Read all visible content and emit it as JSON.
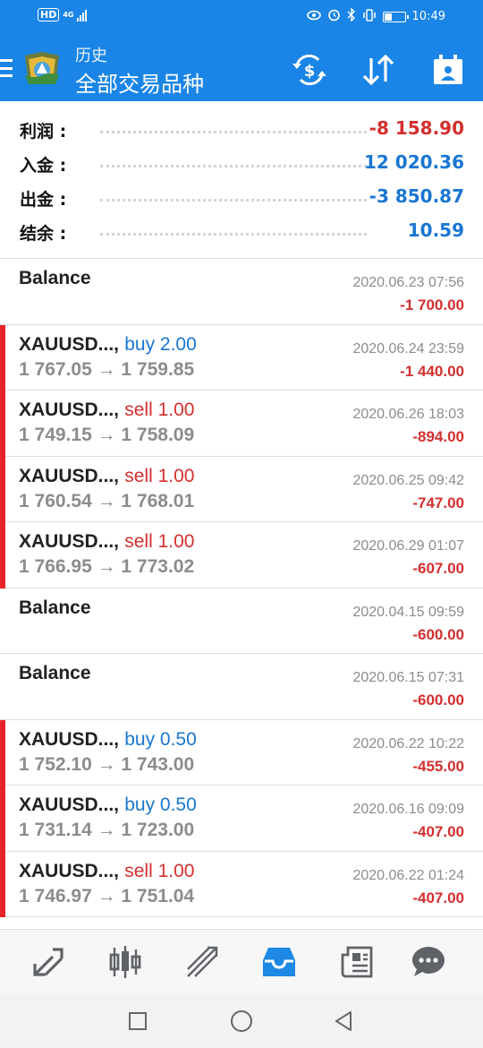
{
  "status_bar": {
    "hd": "HD",
    "network": "4G",
    "time": "10:49",
    "battery_level": 0.35
  },
  "header": {
    "subtitle": "历史",
    "title": "全部交易品种",
    "actions": [
      "currency-exchange-icon",
      "sort-icon",
      "calendar-icon"
    ]
  },
  "summary": [
    {
      "label": "利润 :",
      "value": "-8 158.90",
      "color": "#d32f2f"
    },
    {
      "label": "入金 :",
      "value": "12 020.36",
      "color": "#1976d2"
    },
    {
      "label": "出金 :",
      "value": "-3 850.87",
      "color": "#1976d2"
    },
    {
      "label": "结余 :",
      "value": "10.59",
      "color": "#1976d2"
    }
  ],
  "deals": [
    {
      "kind": "balance",
      "title": "Balance",
      "time": "2020.06.23 07:56",
      "profit": "-1 700.00"
    },
    {
      "kind": "trade",
      "symbol": "XAUUSD...,",
      "side": "buy 2.00",
      "side_color": "#1976d2",
      "prices": "1 767.05 → 1 759.85",
      "time": "2020.06.24 23:59",
      "profit": "-1 440.00"
    },
    {
      "kind": "trade",
      "symbol": "XAUUSD...,",
      "side": "sell 1.00",
      "side_color": "#d32f2f",
      "prices": "1 749.15 → 1 758.09",
      "time": "2020.06.26 18:03",
      "profit": "-894.00"
    },
    {
      "kind": "trade",
      "symbol": "XAUUSD...,",
      "side": "sell 1.00",
      "side_color": "#d32f2f",
      "prices": "1 760.54 → 1 768.01",
      "time": "2020.06.25 09:42",
      "profit": "-747.00"
    },
    {
      "kind": "trade",
      "symbol": "XAUUSD...,",
      "side": "sell 1.00",
      "side_color": "#d32f2f",
      "prices": "1 766.95 → 1 773.02",
      "time": "2020.06.29 01:07",
      "profit": "-607.00"
    },
    {
      "kind": "balance",
      "title": "Balance",
      "time": "2020.04.15 09:59",
      "profit": "-600.00"
    },
    {
      "kind": "balance",
      "title": "Balance",
      "time": "2020.06.15 07:31",
      "profit": "-600.00"
    },
    {
      "kind": "trade",
      "symbol": "XAUUSD...,",
      "side": "buy 0.50",
      "side_color": "#1976d2",
      "prices": "1 752.10 → 1 743.00",
      "time": "2020.06.22 10:22",
      "profit": "-455.00"
    },
    {
      "kind": "trade",
      "symbol": "XAUUSD...,",
      "side": "buy 0.50",
      "side_color": "#1976d2",
      "prices": "1 731.14 → 1 723.00",
      "time": "2020.06.16 09:09",
      "profit": "-407.00"
    },
    {
      "kind": "trade",
      "symbol": "XAUUSD...,",
      "side": "sell 1.00",
      "side_color": "#d32f2f",
      "prices": "1 746.97 → 1 751.04",
      "time": "2020.06.22 01:24",
      "profit": "-407.00"
    }
  ],
  "colors": {
    "accent": "#1a85e6",
    "loss": "#d32f2f",
    "gain": "#1976d2",
    "trade_flag": "#e8232a",
    "nav_active": "#1e88e5",
    "nav_inactive": "#5f6368"
  },
  "bottom_nav": [
    {
      "icon": "quotes-icon",
      "active": false
    },
    {
      "icon": "chart-candles-icon",
      "active": false
    },
    {
      "icon": "trade-icon",
      "active": false
    },
    {
      "icon": "history-icon",
      "active": true
    },
    {
      "icon": "news-icon",
      "active": false
    },
    {
      "icon": "chat-icon",
      "active": false
    }
  ],
  "system_nav": [
    "recents-icon",
    "home-icon",
    "back-icon"
  ]
}
